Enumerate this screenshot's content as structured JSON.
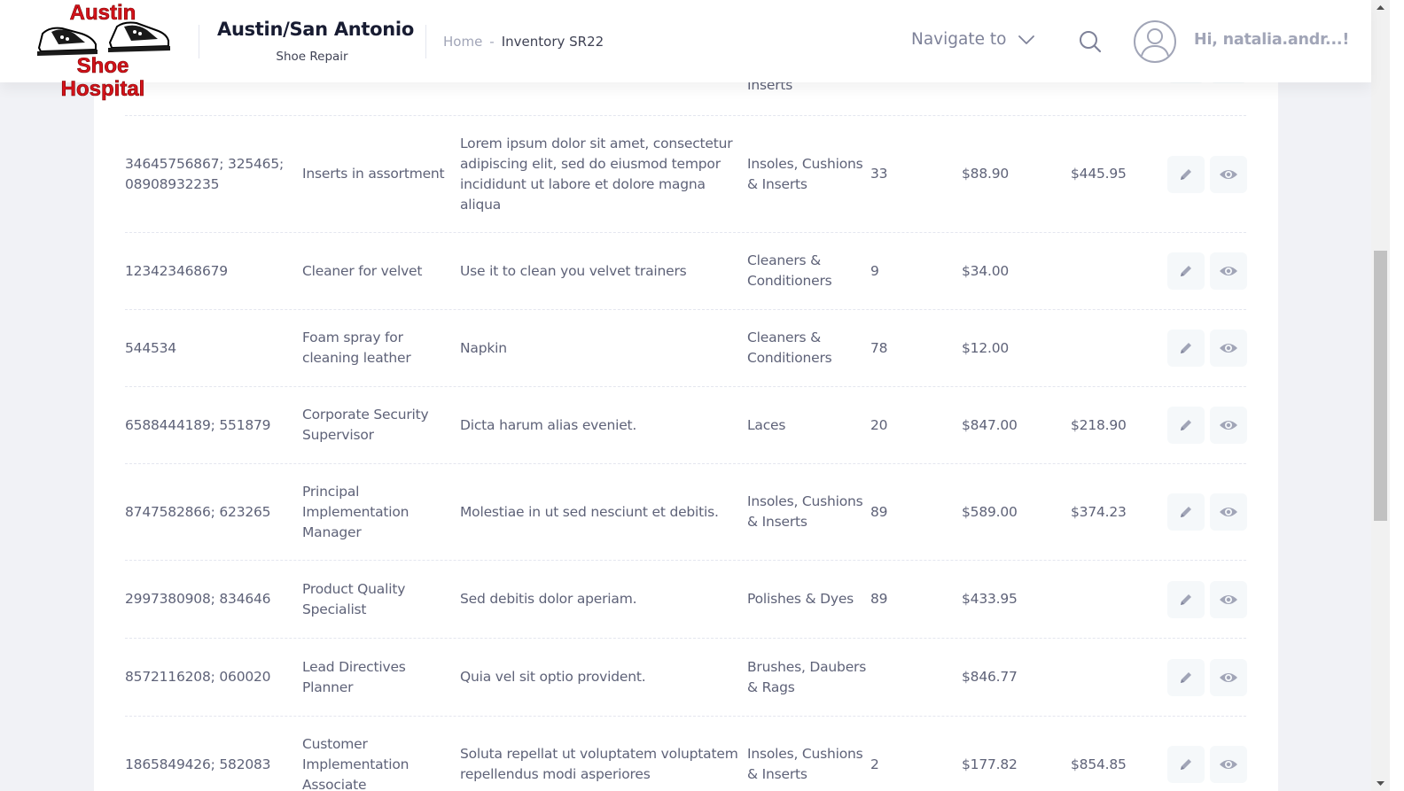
{
  "header": {
    "logo_line1": "Austin",
    "logo_line2": "Shoe Hospital",
    "brand_title": "Austin/San Antonio",
    "brand_subtitle": "Shoe Repair",
    "breadcrumb": {
      "home": "Home",
      "separator": "-",
      "current": "Inventory SR22"
    },
    "navigate_label": "Navigate to",
    "greeting": "Hi, natalia.andr...!"
  },
  "table": {
    "partial_top_category": "Inserts",
    "rows": [
      {
        "sku": "34645756867; 325465; 08908932235",
        "name": "Inserts in assortment",
        "description": "Lorem ipsum dolor sit amet, consectetur adipiscing elit, sed do eiusmod tempor incididunt ut labore et dolore magna aliqua",
        "category": "Insoles, Cushions & Inserts",
        "qty": "33",
        "price": "$88.90",
        "cost": "$445.95"
      },
      {
        "sku": "123423468679",
        "name": "Cleaner for velvet",
        "description": "Use it to clean you velvet trainers",
        "category": "Cleaners & Conditioners",
        "qty": "9",
        "price": "$34.00",
        "cost": ""
      },
      {
        "sku": "544534",
        "name": "Foam spray for cleaning leather",
        "description": "Napkin",
        "category": "Cleaners & Conditioners",
        "qty": "78",
        "price": "$12.00",
        "cost": ""
      },
      {
        "sku": "6588444189; 551879",
        "name": "Corporate Security Supervisor",
        "description": "Dicta harum alias eveniet.",
        "category": "Laces",
        "qty": "20",
        "price": "$847.00",
        "cost": "$218.90"
      },
      {
        "sku": "8747582866; 623265",
        "name": "Principal Implementation Manager",
        "description": "Molestiae in ut sed nesciunt et debitis.",
        "category": "Insoles, Cushions & Inserts",
        "qty": "89",
        "price": "$589.00",
        "cost": "$374.23"
      },
      {
        "sku": "2997380908; 834646",
        "name": "Product Quality Specialist",
        "description": "Sed debitis dolor aperiam.",
        "category": "Polishes & Dyes",
        "qty": "89",
        "price": "$433.95",
        "cost": ""
      },
      {
        "sku": "8572116208; 060020",
        "name": "Lead Directives Planner",
        "description": "Quia vel sit optio provident.",
        "category": "Brushes, Daubers & Rags",
        "qty": "",
        "price": "$846.77",
        "cost": ""
      },
      {
        "sku": "1865849426; 582083",
        "name": "Customer Implementation Associate",
        "description": "Soluta repellat ut voluptatem voluptatem repellendus modi asperiores",
        "category": "Insoles, Cushions & Inserts",
        "qty": "2",
        "price": "$177.82",
        "cost": "$854.85"
      }
    ],
    "action_icons": [
      "pencil-icon",
      "eye-icon"
    ]
  },
  "colors": {
    "logo_red": "#d4121a",
    "text_primary": "#181c32",
    "text_muted": "#a1a5b7",
    "row_text": "#5e6278",
    "page_bg": "#f1f2f6"
  }
}
